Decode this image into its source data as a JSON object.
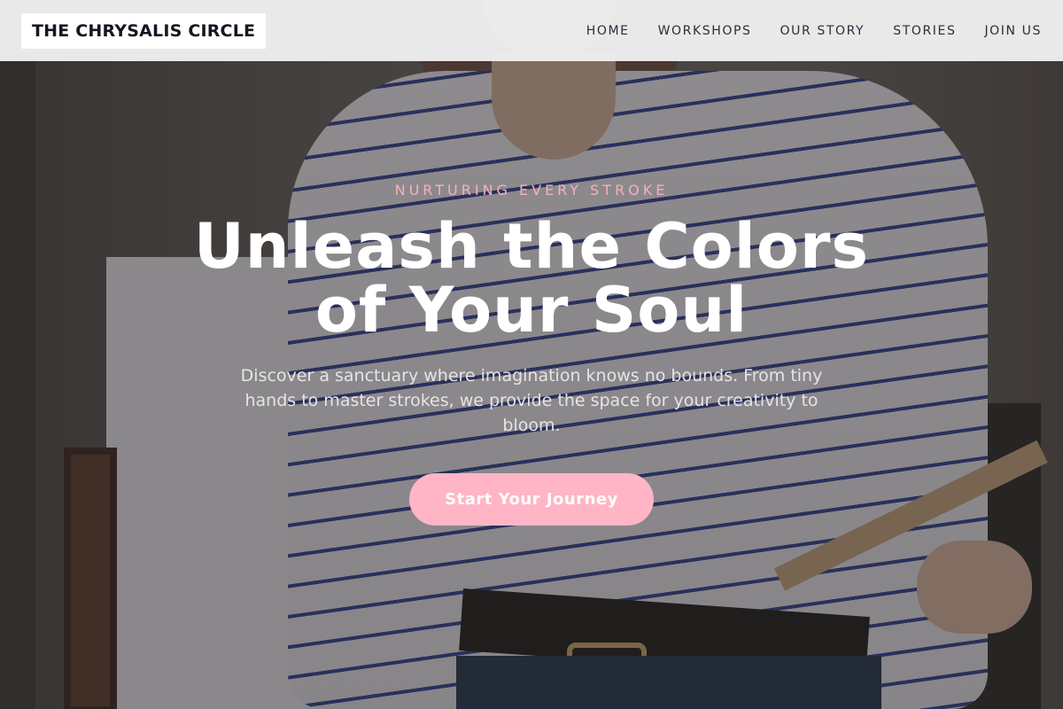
{
  "header": {
    "logo": "THE CHRYSALIS CIRCLE",
    "nav": [
      {
        "label": "HOME"
      },
      {
        "label": "WORKSHOPS"
      },
      {
        "label": "OUR STORY"
      },
      {
        "label": "STORIES"
      },
      {
        "label": "JOIN US"
      }
    ]
  },
  "hero": {
    "eyebrow": "NURTURING EVERY STROKE",
    "headline_line1": "Unleash the Colors",
    "headline_line2": "of Your Soul",
    "subtext": "Discover a sanctuary where imagination knows no bounds. From tiny hands to master strokes, we provide the space for your creativity to bloom.",
    "cta_label": "Start Your Journey"
  },
  "colors": {
    "accent_pink": "#ffb5c5",
    "eyebrow_pink": "#f7aebe",
    "header_bg": "#f0f0f0",
    "nav_text": "#2a2d3a"
  }
}
